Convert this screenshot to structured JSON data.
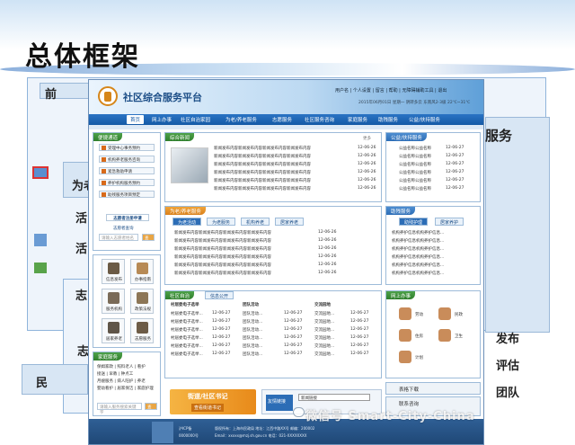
{
  "slide": {
    "title": "总体框架",
    "left_fragments": [
      "前",
      "为老",
      "活",
      "活",
      "志",
      "志",
      "志"
    ],
    "left_bottom": "民",
    "right_fragments": [
      "服务",
      "发布",
      "评估",
      "团队"
    ]
  },
  "header": {
    "site_title": "社区综合服务平台",
    "top_links": "用户名 | 个人设置 | 留言 | 帮助 | 无障碍辅助工具 | 退出",
    "date_line": "2015年06月01日 星期一 阴转多云 东南风2-3级 22℃~31℃"
  },
  "nav": {
    "items": [
      "首页",
      "网上办事",
      "社区自治家园",
      "为老/养老服务",
      "志愿服务",
      "社区服务咨询",
      "家庭服务",
      "助残服务",
      "公益/扶持服务"
    ]
  },
  "quick": {
    "title": "便捷通道",
    "items": [
      "受理中心事务预约",
      "机构养老服务咨询",
      "紧急救助申请",
      "养护机构服务预约",
      "助残服务项目预定"
    ],
    "volunteer_btn": "志愿者注册申请",
    "volunteer_query": "志愿者查询",
    "volunteer_placeholder": "请输入志愿者姓名",
    "search_btn": "查询"
  },
  "icons": {
    "items": [
      "信息发布",
      "办事指南",
      "服务机构",
      "政策法规",
      "居家养老",
      "志愿服务"
    ]
  },
  "family": {
    "title": "家庭服务",
    "lines": [
      "保姆家政",
      "照料老人",
      "看护",
      "接送",
      "早教",
      "钟点工",
      "月嫂服务",
      "病人陪护",
      "养老",
      "婴幼看护",
      "居家保洁",
      "家庭护理"
    ],
    "placeholder": "请输入服务搜索关键字",
    "btn": "查询"
  },
  "news": {
    "title": "综合新闻",
    "more": "更多",
    "rows": [
      {
        "text": "新闻发布内容新闻发布内容新闻发布内容新闻发布内容",
        "date": "12-06-26"
      },
      {
        "text": "新闻发布内容新闻发布内容新闻发布内容新闻发布内容",
        "date": "12-06-26"
      },
      {
        "text": "新闻发布内容新闻发布内容新闻发布内容新闻发布内容",
        "date": "12-06-26"
      },
      {
        "text": "新闻发布内容新闻发布内容新闻发布内容新闻发布内容",
        "date": "12-06-26"
      },
      {
        "text": "新闻发布内容新闻发布内容新闻发布内容新闻发布内容",
        "date": "12-06-26"
      },
      {
        "text": "新闻发布内容新闻发布内容新闻发布内容新闻发布内容",
        "date": "12-06-26"
      }
    ]
  },
  "elder": {
    "title": "为老/养老服务",
    "tabs": [
      "为老活动",
      "为老服务",
      "机构养老",
      "居家养老"
    ],
    "rows": [
      {
        "text": "新闻发布内容新闻发布内容新闻发布内容新闻发布内容",
        "date": "12-06-26"
      },
      {
        "text": "新闻发布内容新闻发布内容新闻发布内容新闻发布内容",
        "date": "12-06-26"
      },
      {
        "text": "新闻发布内容新闻发布内容新闻发布内容新闻发布内容",
        "date": "12-06-26"
      },
      {
        "text": "新闻发布内容新闻发布内容新闻发布内容新闻发布内容",
        "date": "12-06-26"
      },
      {
        "text": "新闻发布内容新闻发布内容新闻发布内容新闻发布内容",
        "date": "12-06-26"
      },
      {
        "text": "新闻发布内容新闻发布内容新闻发布内容新闻发布内容",
        "date": "12-06-26"
      }
    ]
  },
  "charity": {
    "title": "公益/扶持服务",
    "rows": [
      {
        "text": "公益名称公益名称",
        "date": "12-06-27"
      },
      {
        "text": "公益名称公益名称",
        "date": "12-06-27"
      },
      {
        "text": "公益名称公益名称",
        "date": "12-06-27"
      },
      {
        "text": "公益名称公益名称",
        "date": "12-06-27"
      },
      {
        "text": "公益名称公益名称",
        "date": "12-06-27"
      },
      {
        "text": "公益名称公益名称",
        "date": "12-06-27"
      }
    ]
  },
  "disabled": {
    "title": "助残服务",
    "tabs": [
      "助残护理",
      "居家养护"
    ],
    "rows": [
      {
        "text": "机构养护信息机构养护信息..."
      },
      {
        "text": "机构养护信息机构养护信息..."
      },
      {
        "text": "机构养护信息机构养护信息..."
      },
      {
        "text": "机构养护信息机构养护信息..."
      },
      {
        "text": "机构养护信息机构养护信息..."
      },
      {
        "text": "机构养护信息机构养护信息..."
      }
    ]
  },
  "community": {
    "title": "社区自治",
    "tab2": "信息公开",
    "cols": [
      {
        "head": "村居委电子选举",
        "rows": [
          "村居委电子选举...",
          "村居委电子选举...",
          "村居委电子选举...",
          "村居委电子选举...",
          "村居委电子选举...",
          "村居委电子选举..."
        ],
        "date": "12-06-27"
      },
      {
        "head": "团队活动",
        "rows": [
          "团队活动...",
          "团队活动...",
          "团队活动...",
          "团队活动...",
          "团队活动...",
          "团队活动..."
        ],
        "date": "12-06-27"
      },
      {
        "head": "交流园地",
        "rows": [
          "交流园地...",
          "交流园地...",
          "交流园地...",
          "交流园地...",
          "交流园地...",
          "交流园地..."
        ],
        "date": "12-06-27"
      }
    ]
  },
  "online": {
    "title": "网上办事",
    "items": [
      "劳动",
      "民政",
      "住房",
      "卫生",
      "计划"
    ]
  },
  "banner": {
    "title": "街道/社区书记",
    "btn": "查看街道书记",
    "links_label": "友情链接",
    "select": "新闻链接"
  },
  "side_links": [
    "表格下载",
    "联系咨询"
  ],
  "footer": {
    "left": "沪ICP备",
    "left2": "0000000号",
    "mid": "版权所有：上海市民政局  地址：江西中路XX号  邮编：200002",
    "mid2": "Email：xxxxx@mzj.sh.gov.cn  电话：021-XXXXXXXX"
  },
  "watermark": "微信号 Smart-City-China"
}
